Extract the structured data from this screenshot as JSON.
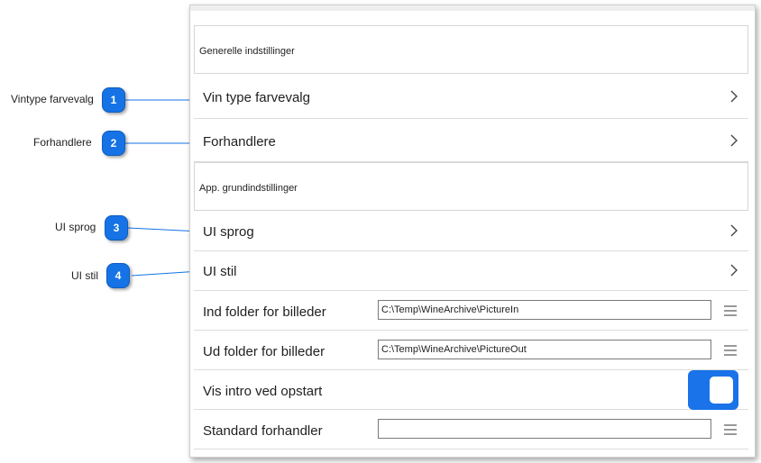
{
  "colors": {
    "accent": "#1a73e8",
    "badge": "#1573e6",
    "callout_line": "#1573e6"
  },
  "sections": [
    {
      "title": "Generelle indstillinger"
    },
    {
      "title": "App. grundindstillinger"
    }
  ],
  "rows": {
    "wine_type_colors": {
      "label": "Vin type farvevalg",
      "icon": "chevron-right-icon"
    },
    "dealers": {
      "label": "Forhandlere",
      "icon": "chevron-right-icon"
    },
    "ui_language": {
      "label": "UI sprog",
      "icon": "chevron-right-icon"
    },
    "ui_style": {
      "label": "UI stil",
      "icon": "chevron-right-icon"
    },
    "picture_in_folder": {
      "label": "Ind folder for billeder",
      "value": "C:\\Temp\\WineArchive\\PictureIn",
      "icon": "menu-icon"
    },
    "picture_out_folder": {
      "label": "Ud folder for billeder",
      "value": "C:\\Temp\\WineArchive\\PictureOut",
      "icon": "menu-icon"
    },
    "show_intro": {
      "label": "Vis intro ved opstart",
      "on": true
    },
    "default_dealer": {
      "label": "Standard forhandler",
      "value": "",
      "icon": "menu-icon"
    }
  },
  "callouts": [
    {
      "number": "1",
      "label": "Vintype farvevalg"
    },
    {
      "number": "2",
      "label": "Forhandlere"
    },
    {
      "number": "3",
      "label": "UI sprog"
    },
    {
      "number": "4",
      "label": "UI stil"
    }
  ]
}
